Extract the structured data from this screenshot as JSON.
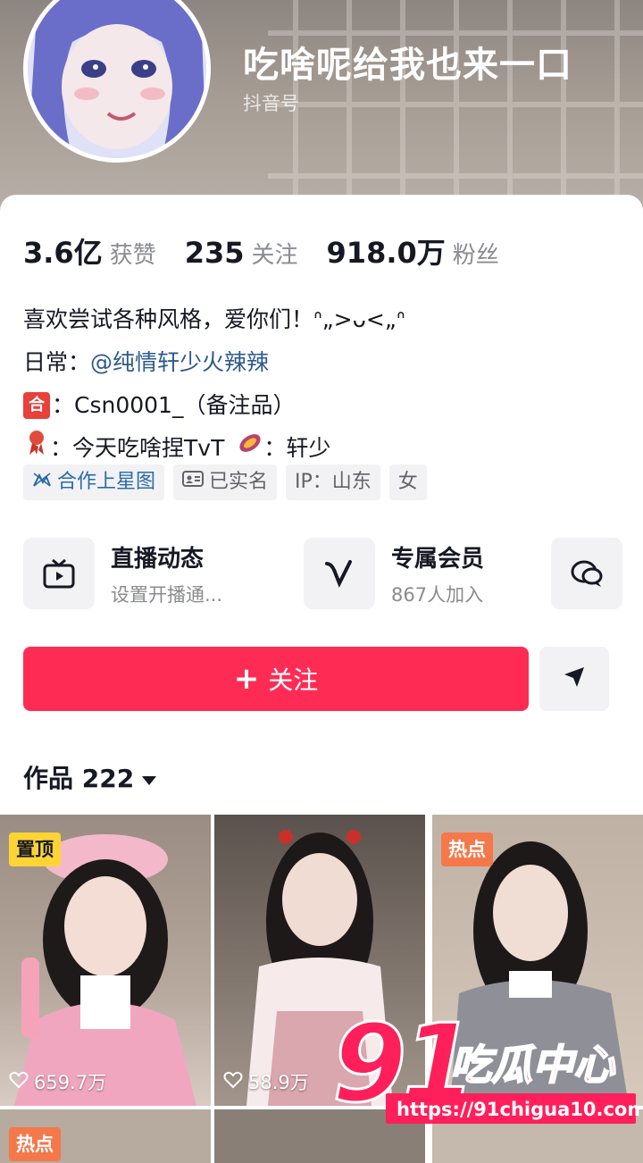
{
  "profile": {
    "nickname": "吃啥呢给我也来一口",
    "douyin_id": "抖音号"
  },
  "stats": [
    {
      "value": "3.6亿",
      "label": "获赞"
    },
    {
      "value": "235",
      "label": "关注"
    },
    {
      "value": "918.0万",
      "label": "粉丝"
    }
  ],
  "bio": {
    "line1": "喜欢尝试各种风格，爱你们！ᐢ„>ᴗ<„ᐢ",
    "line2_prefix": "日常：",
    "line2_mention": "@纯情轩少火辣辣",
    "line3_icon": "合",
    "line3_text": "：Csn0001_（备注品）",
    "line4_text_a": "：今天吃啥捏TvT",
    "line4_text_b": "：轩少"
  },
  "tags": [
    {
      "label": "合作上星图",
      "icon": "star-map-icon"
    },
    {
      "label": "已实名",
      "icon": "id-card-icon"
    },
    {
      "label": "IP：山东"
    },
    {
      "label": "女"
    }
  ],
  "features": [
    {
      "title": "直播动态",
      "sub": "设置开播通...",
      "icon": "tv-icon"
    },
    {
      "title": "专属会员",
      "sub": "867人加入",
      "icon": "v-icon"
    },
    {
      "title": "",
      "sub": "",
      "icon": "chat-icon"
    }
  ],
  "actions": {
    "follow_label": "关注"
  },
  "works": {
    "tab_label": "作品 222"
  },
  "grid": [
    {
      "badge": "置顶",
      "likes": "659.7万",
      "badge_color": "#fcd535"
    },
    {
      "badge": "",
      "likes": "58.9万"
    },
    {
      "badge": "热点",
      "likes": "",
      "badge_color": "#f5784b"
    },
    {
      "badge": "热点",
      "likes": ""
    }
  ],
  "watermark": {
    "logo": "91",
    "brand": "吃瓜中心",
    "url": "https://91chigua10.com"
  },
  "colors": {
    "accent": "#fe2c55",
    "mention": "#2e5a8c",
    "tag_blue": "#2a6ba8"
  }
}
